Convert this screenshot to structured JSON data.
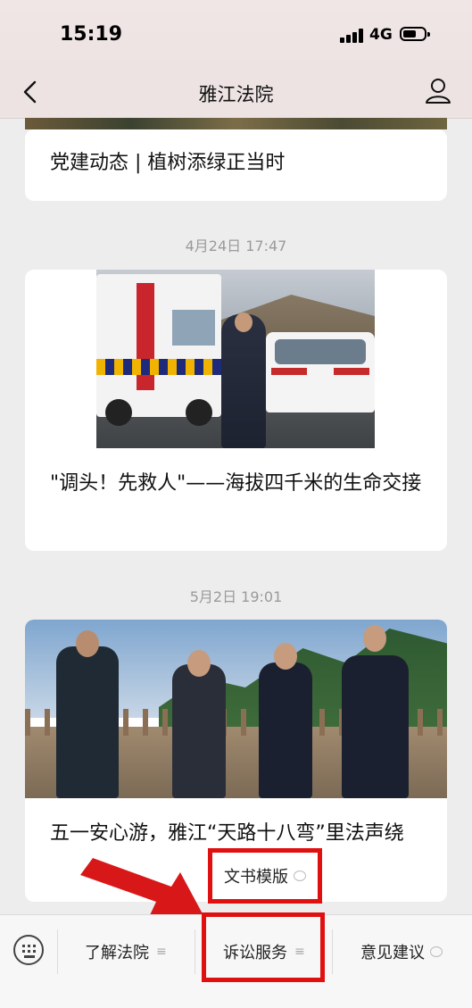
{
  "status_bar": {
    "time": "15:19",
    "network": "4G"
  },
  "nav": {
    "title": "雅江法院",
    "back_icon": "chevron-left-icon",
    "profile_icon": "person-icon"
  },
  "feed": {
    "articles": [
      {
        "title": "党建动态 | 植树添绿正当时"
      },
      {
        "timestamp": "4月24日 17:47",
        "title": "\"调头！先救人\"——海拔四千米的生命交接"
      },
      {
        "timestamp": "5月2日 19:01",
        "title": "五一安心游，雅江“天路十八弯”里法声绕"
      }
    ]
  },
  "popup_menu": {
    "item": "文书模版"
  },
  "bottom_menu": {
    "items": [
      {
        "label": "了解法院",
        "icon": "list-icon"
      },
      {
        "label": "诉讼服务",
        "icon": "list-icon"
      },
      {
        "label": "意见建议",
        "icon": "chat-bubble-icon"
      }
    ]
  },
  "colors": {
    "annotation_red": "#e01010",
    "background": "#ededed"
  }
}
